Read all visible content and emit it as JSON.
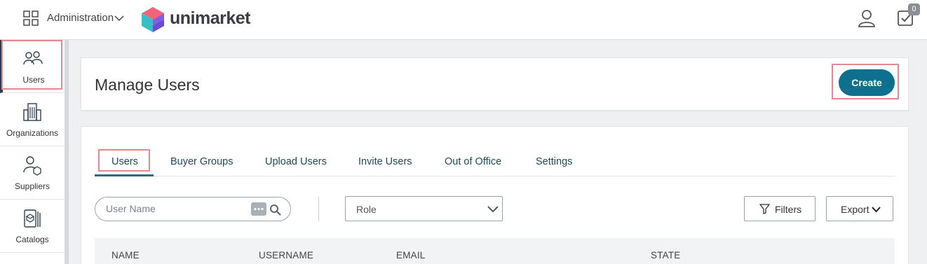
{
  "header": {
    "app_switcher_label": "Administration",
    "logo_text": "unimarket",
    "task_badge_count": "0",
    "icons": {
      "app_grid": "grid-icon",
      "user": "user-icon",
      "tasks": "tasks-check-icon",
      "chevron": "chevron-down-icon"
    }
  },
  "sidebar": {
    "items": [
      {
        "label": "Users",
        "icon": "users-icon",
        "active": true
      },
      {
        "label": "Organizations",
        "icon": "buildings-icon",
        "active": false
      },
      {
        "label": "Suppliers",
        "icon": "supplier-icon",
        "active": false
      },
      {
        "label": "Catalogs",
        "icon": "catalog-icon",
        "active": false
      }
    ]
  },
  "page": {
    "title": "Manage Users",
    "create_label": "Create"
  },
  "tabs": [
    {
      "label": "Users",
      "active": true
    },
    {
      "label": "Buyer Groups",
      "active": false
    },
    {
      "label": "Upload Users",
      "active": false
    },
    {
      "label": "Invite Users",
      "active": false
    },
    {
      "label": "Out of Office",
      "active": false
    },
    {
      "label": "Settings",
      "active": false
    }
  ],
  "filters": {
    "search_placeholder": "User Name",
    "role_placeholder": "Role",
    "filters_label": "Filters",
    "export_label": "Export"
  },
  "table": {
    "columns": [
      "NAME",
      "USERNAME",
      "EMAIL",
      "STATE"
    ]
  },
  "colors": {
    "accent": "#0f6f8f",
    "tab_text": "#1d4a5c",
    "highlight": "#e28a92"
  }
}
